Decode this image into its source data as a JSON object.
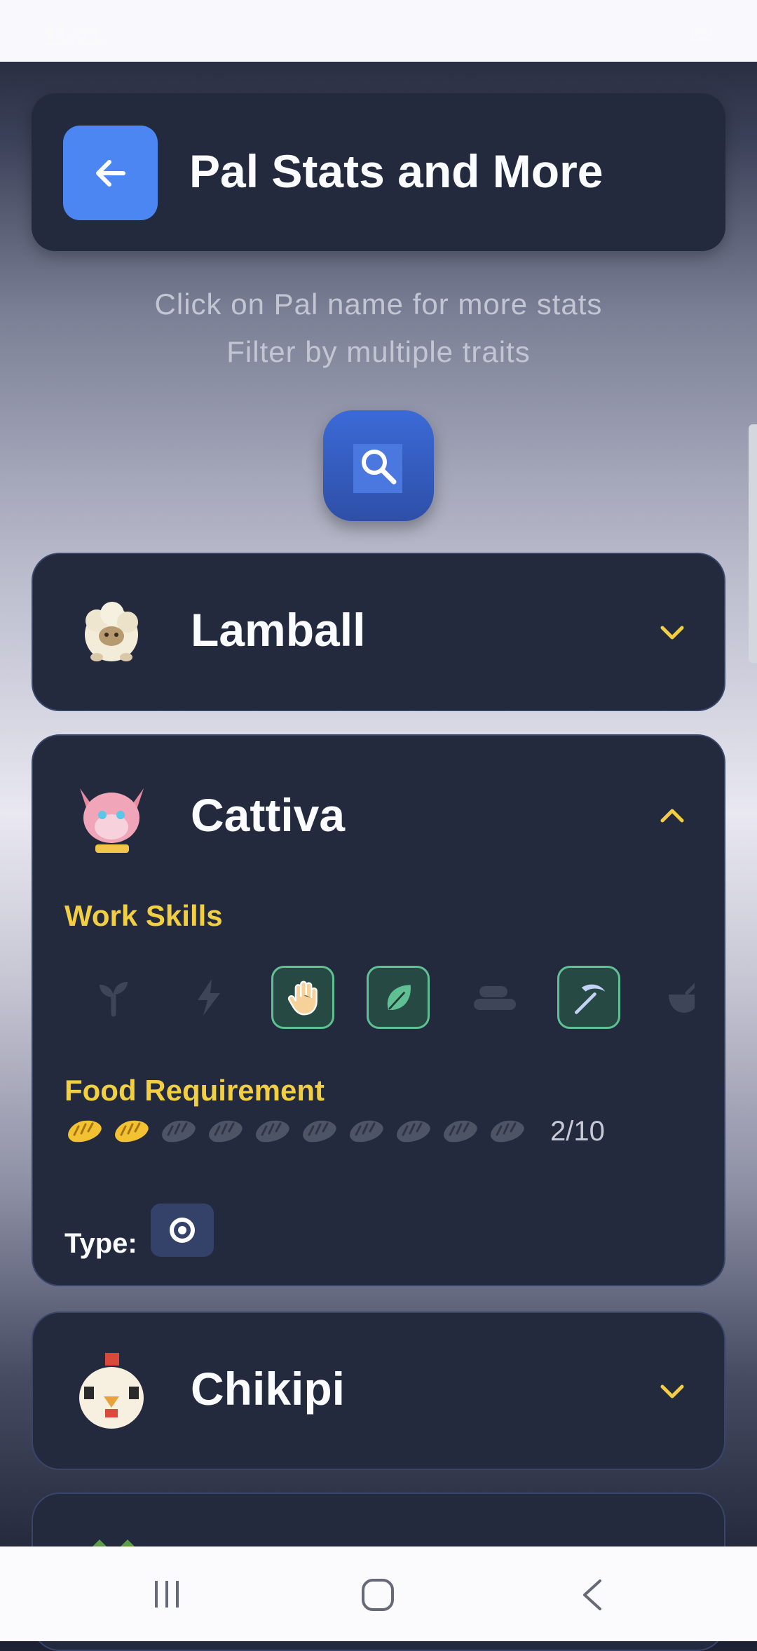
{
  "status_bar": {
    "time": "11:21",
    "battery": "82"
  },
  "header": {
    "title": "Pal Stats and More",
    "back_icon": "arrow-left-icon"
  },
  "hints": [
    "Click on Pal name for more stats",
    "Filter by multiple traits"
  ],
  "search_icon": "search-icon",
  "pals": [
    {
      "name": "Lamball",
      "expanded": false
    },
    {
      "name": "Cattiva",
      "expanded": true,
      "work_skills_title": "Work Skills",
      "work_skills": [
        {
          "icon": "sprout-icon",
          "active": false
        },
        {
          "icon": "lightning-icon",
          "active": false
        },
        {
          "icon": "hand-icon",
          "active": true
        },
        {
          "icon": "leaf-icon",
          "active": true
        },
        {
          "icon": "lumber-icon",
          "active": false
        },
        {
          "icon": "pickaxe-icon",
          "active": true
        },
        {
          "icon": "bowl-icon",
          "active": false
        }
      ],
      "food_title": "Food Requirement",
      "food_filled": 2,
      "food_total": 10,
      "food_text": "2/10",
      "type_label": "Type:",
      "type_icon": "neutral-element-icon"
    },
    {
      "name": "Chikipi",
      "expanded": false
    }
  ],
  "colors": {
    "accent": "#4c86f2",
    "gold": "#f2ce42",
    "card": "#232a3e",
    "skill_active_border": "#5fc193"
  },
  "navbar": {
    "recent": "recent-apps-icon",
    "home": "home-icon",
    "back": "back-icon"
  }
}
